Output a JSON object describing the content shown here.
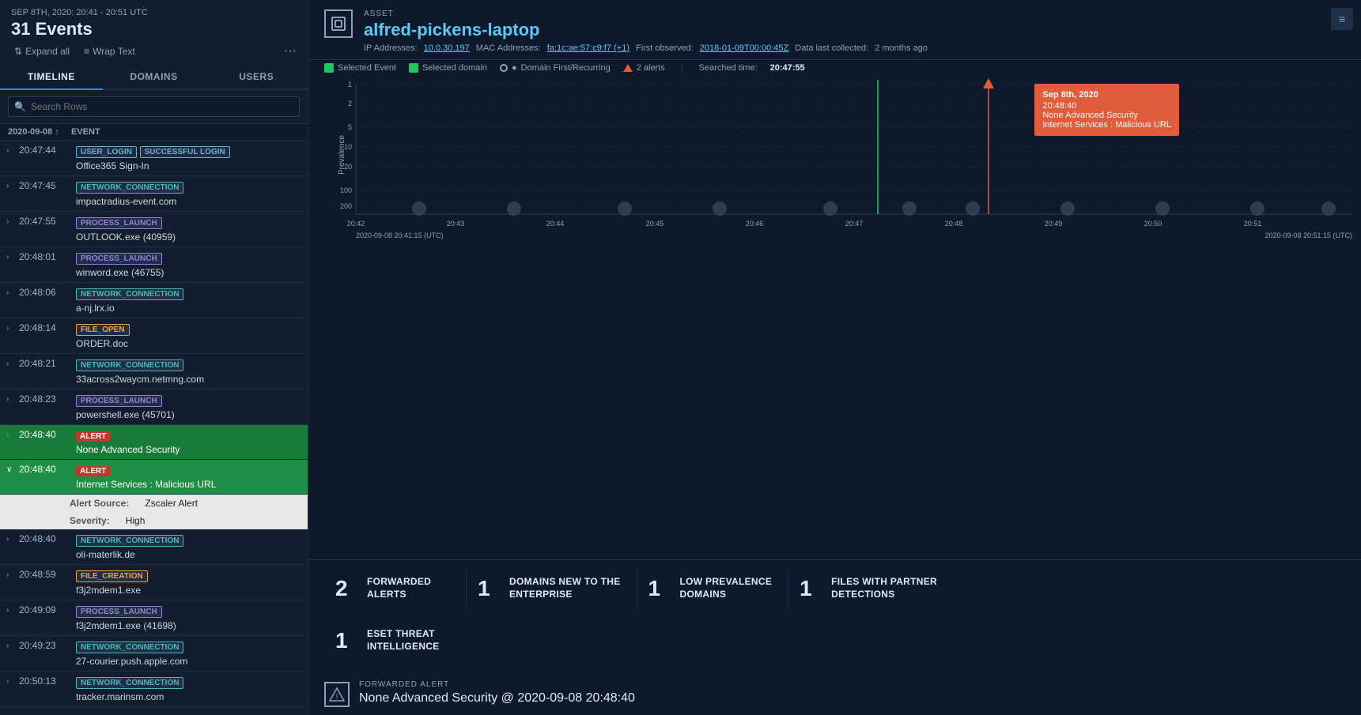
{
  "header": {
    "date_range": "SEP 8TH, 2020: 20:41 - 20:51 UTC",
    "event_count": "31 Events",
    "expand_all": "Expand all",
    "wrap_text": "Wrap Text"
  },
  "tabs": [
    {
      "label": "TIMELINE",
      "active": true
    },
    {
      "label": "DOMAINS",
      "active": false
    },
    {
      "label": "USERS",
      "active": false
    }
  ],
  "search": {
    "placeholder": "Search Rows"
  },
  "table_header": {
    "col1": "2020-09-08",
    "col2": "EVENT"
  },
  "events": [
    {
      "time": "20:47:44",
      "badges": [
        "USER_LOGIN",
        "SUCCESSFUL LOGIN"
      ],
      "badge_types": [
        "user-login",
        "success-login"
      ],
      "desc": "Office365 Sign-In",
      "expanded": false,
      "active": false
    },
    {
      "time": "20:47:45",
      "badges": [
        "NETWORK_CONNECTION"
      ],
      "badge_types": [
        "network"
      ],
      "desc": "impactradius-event.com",
      "expanded": false,
      "active": false
    },
    {
      "time": "20:47:55",
      "badges": [
        "PROCESS_LAUNCH"
      ],
      "badge_types": [
        "process"
      ],
      "desc": "OUTLOOK.exe (40959)",
      "expanded": false,
      "active": false
    },
    {
      "time": "20:48:01",
      "badges": [
        "PROCESS_LAUNCH"
      ],
      "badge_types": [
        "process"
      ],
      "desc": "winword.exe (46755)",
      "expanded": false,
      "active": false
    },
    {
      "time": "20:48:06",
      "badges": [
        "NETWORK_CONNECTION"
      ],
      "badge_types": [
        "network"
      ],
      "desc": "a-nj.lrx.io",
      "expanded": false,
      "active": false
    },
    {
      "time": "20:48:14",
      "badges": [
        "FILE_OPEN"
      ],
      "badge_types": [
        "file-open"
      ],
      "desc": "ORDER.doc",
      "expanded": false,
      "active": false
    },
    {
      "time": "20:48:21",
      "badges": [
        "NETWORK_CONNECTION"
      ],
      "badge_types": [
        "network"
      ],
      "desc": "33across2waycm.netmng.com",
      "expanded": false,
      "active": false
    },
    {
      "time": "20:48:23",
      "badges": [
        "PROCESS_LAUNCH"
      ],
      "badge_types": [
        "process"
      ],
      "desc": "powershell.exe (45701)",
      "expanded": false,
      "active": false
    },
    {
      "time": "20:48:40",
      "badges": [
        "ALERT"
      ],
      "badge_types": [
        "alert"
      ],
      "desc": "None Advanced Security",
      "expanded": false,
      "active": true
    },
    {
      "time": "20:48:40",
      "badges": [
        "ALERT"
      ],
      "badge_types": [
        "alert"
      ],
      "desc": "Internet Services : Malicious URL",
      "expanded": true,
      "active": true,
      "details": [
        {
          "label": "Alert Source:",
          "value": "Zscaler Alert"
        },
        {
          "label": "Severity:",
          "value": "High"
        }
      ]
    },
    {
      "time": "20:48:40",
      "badges": [
        "NETWORK_CONNECTION"
      ],
      "badge_types": [
        "network"
      ],
      "desc": "oli-materlik.de",
      "expanded": false,
      "active": false
    },
    {
      "time": "20:48:59",
      "badges": [
        "FILE_CREATION"
      ],
      "badge_types": [
        "file-creation"
      ],
      "desc": "f3j2mdem1.exe",
      "expanded": false,
      "active": false
    },
    {
      "time": "20:49:09",
      "badges": [
        "PROCESS_LAUNCH"
      ],
      "badge_types": [
        "process"
      ],
      "desc": "f3j2mdem1.exe (41698)",
      "expanded": false,
      "active": false
    },
    {
      "time": "20:49:23",
      "badges": [
        "NETWORK_CONNECTION"
      ],
      "badge_types": [
        "network"
      ],
      "desc": "27-courier.push.apple.com",
      "expanded": false,
      "active": false
    },
    {
      "time": "20:50:13",
      "badges": [
        "NETWORK_CONNECTION"
      ],
      "badge_types": [
        "network"
      ],
      "desc": "tracker.marinsm.com",
      "expanded": false,
      "active": false
    }
  ],
  "asset": {
    "label": "ASSET",
    "icon": "□",
    "name": "alfred-pickens-laptop",
    "ip_label": "IP Addresses:",
    "ip": "10.0.30.197",
    "mac_label": "MAC Addresses:",
    "mac": "fa:1c:ae:57:c9:f7 (+1)",
    "first_observed_label": "First observed:",
    "first_observed": "2018-01-09T00:00:45Z",
    "data_label": "Data last collected:",
    "data_collected": "2 months ago"
  },
  "legend": {
    "selected_event": "Selected Event",
    "selected_domain": "Selected domain",
    "domain_recurring": "Domain First/Recurring",
    "alerts": "2 alerts",
    "searched_time_label": "Searched time:",
    "searched_time": "20:47:55",
    "color_selected_event": "#22c55e",
    "color_selected_domain": "#22c55e"
  },
  "chart": {
    "x_labels": [
      "20:42",
      "20:43",
      "20:44",
      "20:45",
      "20:46",
      "20:47",
      "20:48",
      "20:49",
      "20:50",
      "20:51"
    ],
    "y_labels": [
      "1",
      "2",
      "5",
      "10",
      "20",
      "100",
      "200"
    ],
    "start_label": "2020-09-08 20:41:15 (UTC)",
    "end_label": "2020-09-08 20:51:15 (UTC)",
    "y_axis_label": "Prevalence"
  },
  "tooltip": {
    "date": "Sep 8th, 2020",
    "time": "20:48:40",
    "line1": "None Advanced Security",
    "line2": "Internet Services : Malicious URL"
  },
  "indicators": [
    {
      "number": "2",
      "label": "FORWARDED\nALERTS"
    },
    {
      "number": "1",
      "label": "DOMAINS NEW TO THE\nENTERPRISE"
    },
    {
      "number": "1",
      "label": "LOW PREVALENCE\nDOMAINS"
    },
    {
      "number": "1",
      "label": "FILES WITH PARTNER\nDETECTIONS"
    },
    {
      "number": "1",
      "label": "ESET THREAT\nINTELLIGENCE"
    }
  ],
  "forwarded_alert": {
    "header": "FORWARDED ALERT",
    "title": "None Advanced Security @ 2020-09-08 20:48:40"
  },
  "settings_btn": "≡"
}
